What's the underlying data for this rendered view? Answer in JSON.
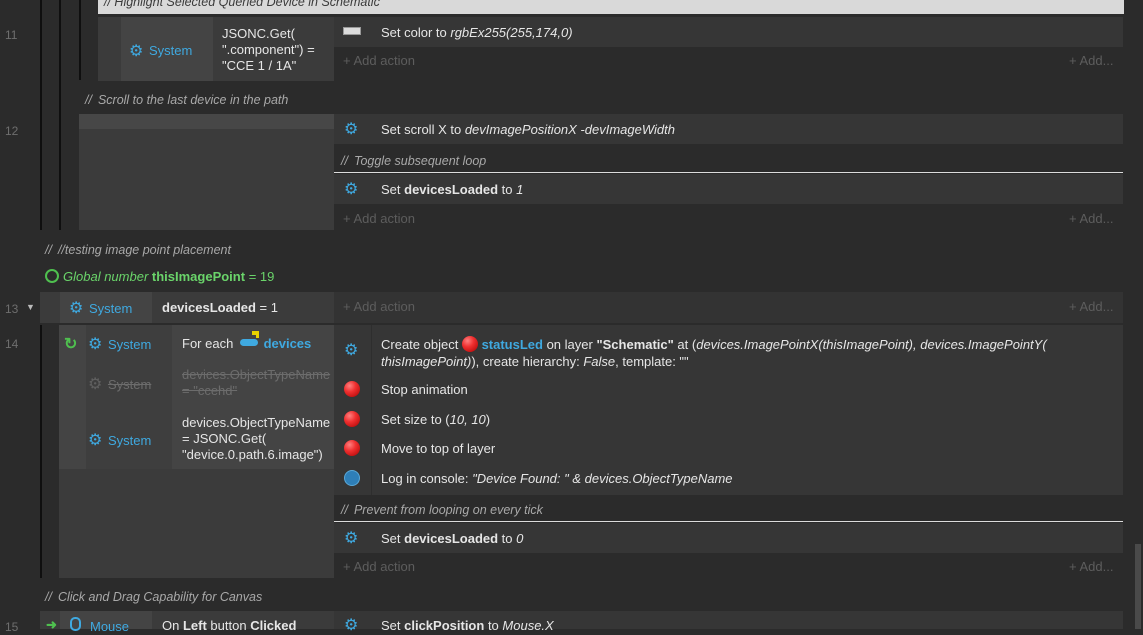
{
  "line_numbers": [
    "11",
    "12",
    "13",
    "14",
    "15"
  ],
  "group_header": "//   Highlight Selected Queried Device in Schematic",
  "comments": {
    "scroll_last": "Scroll to the last device in the path",
    "toggle_loop": "Toggle subsequent loop",
    "testing": "//testing image point placement",
    "prevent_loop": "Prevent from looping on every tick",
    "click_drag": "Click and Drag Capability for Canvas"
  },
  "comment_prefix": "//",
  "add_action": "+ Add action",
  "add_more": "+ Add...",
  "system_label": "System",
  "event11": {
    "cond_line1": "JSONC.Get(",
    "cond_line2": "\".component\") =",
    "cond_line3": "\"CCE 1 / 1A\"",
    "action1_prefix": "Set color to ",
    "action1_value": "rgbEx255(255,174,0)"
  },
  "event12": {
    "action1_prefix": "Set scroll X to ",
    "action1_value": "devImagePositionX -devImageWidth",
    "action2_prefix": "Set ",
    "action2_var": "devicesLoaded",
    "action2_mid": " to ",
    "action2_value": "1"
  },
  "global_var": {
    "prefix": "Global number ",
    "name": "thisImagePoint",
    "suffix": " = 19"
  },
  "event13": {
    "cond_var": "devicesLoaded",
    "cond_suffix": " = 1"
  },
  "event14": {
    "foreach_prefix": "For each",
    "foreach_obj": "devices",
    "disabled_line1": "devices.ObjectTypeName",
    "disabled_line2": "= \"ccehd\"",
    "cond3_line1": "devices.ObjectTypeName",
    "cond3_line2": "= JSONC.Get(",
    "cond3_line3": "\"device.0.path.6.image\")",
    "create_p1": "Create object ",
    "create_obj": "statusLed",
    "create_p2": " on layer ",
    "create_layer": "\"Schematic\"",
    "create_p3": " at (",
    "create_expr1": "devices.ImagePointX(thisImagePoint), devices.ImagePointY(",
    "create_expr2": "thisImagePoint)",
    "create_p4": "), create hierarchy: ",
    "create_false": "False",
    "create_p5": ", template: \"\"",
    "stop_anim": "Stop animation",
    "size_prefix": "Set size to (",
    "size_value": "10, 10",
    "size_suffix": ")",
    "move_top": "Move to top of layer",
    "log_prefix": "Log in console: ",
    "log_value": "\"Device Found: \" & devices.ObjectTypeName",
    "set_prefix": "Set ",
    "set_var": "devicesLoaded",
    "set_mid": " to ",
    "set_value": "0"
  },
  "event15": {
    "obj_label": "Mouse",
    "cond_prefix": "On ",
    "cond_button": "Left",
    "cond_mid": " button ",
    "cond_end": "Clicked",
    "action_prefix": "Set ",
    "action_var": "clickPosition",
    "action_mid": " to ",
    "action_value": "Mouse.X"
  },
  "colors": {
    "background": "#2b2b2b",
    "system_blue": "#3fa9e0",
    "global_green": "#6ad46a",
    "action_row": "#363636"
  }
}
